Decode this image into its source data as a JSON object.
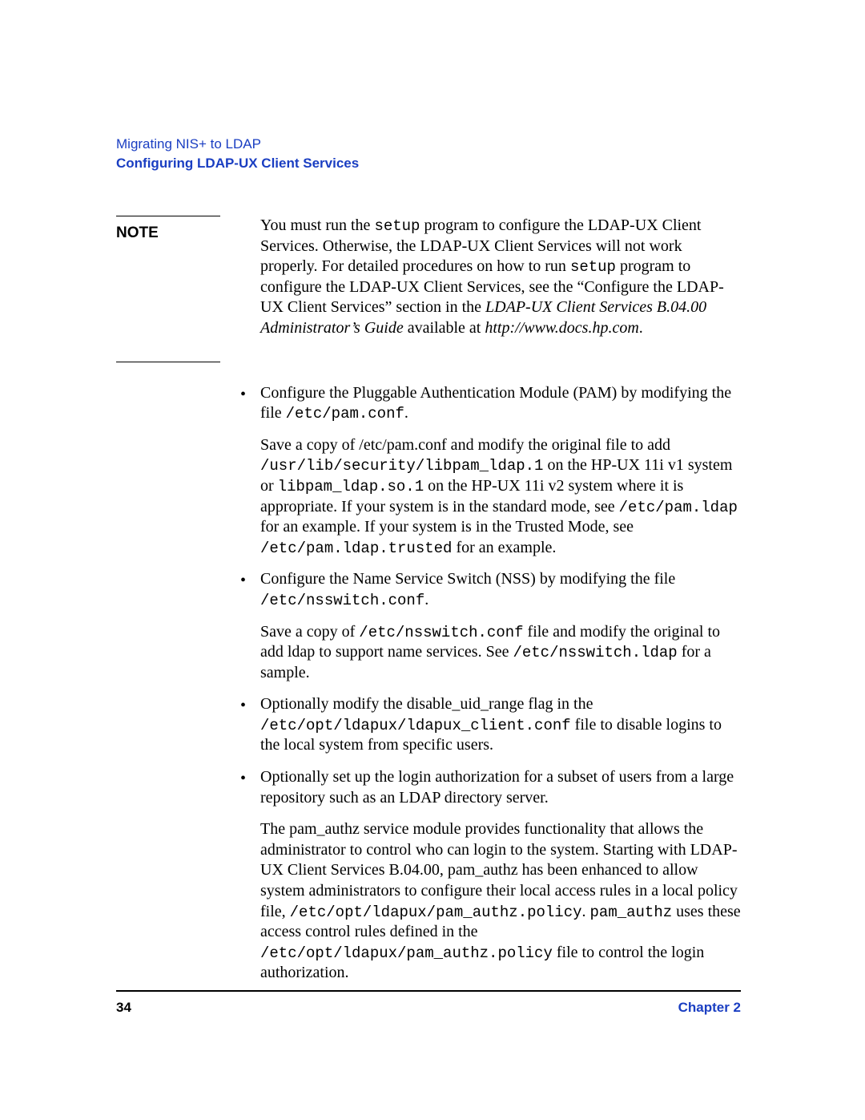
{
  "header": {
    "breadcrumb": "Migrating NIS+ to LDAP",
    "section": "Configuring LDAP-UX Client Services"
  },
  "note": {
    "label": "NOTE",
    "p1_a": "You must run the ",
    "p1_code1": "setup",
    "p1_b": " program to configure the LDAP-UX Client Services. Otherwise, the LDAP-UX Client Services will not work properly. For detailed procedures on how to run ",
    "p1_code2": "setup",
    "p1_c": " program to configure the LDAP-UX Client Services, see the “Configure the LDAP-UX Client Services” section in the ",
    "p1_em1": "LDAP-UX Client Services B.04.00 Administrator’s Guide",
    "p1_d": " available at ",
    "p1_em2": "http://www.docs.hp.com",
    "p1_e": "."
  },
  "bullets": {
    "b1": {
      "t1": "Configure the Pluggable Authentication Module (PAM) by modifying the file ",
      "c1": "/etc/pam.conf",
      "t2": ".",
      "p2_a": " Save a copy of /etc/pam.conf and modify the original file to add ",
      "p2_c1": "/usr/lib/security/libpam_ldap.1",
      "p2_b": " on the HP-UX 11i v1 system or ",
      "p2_c2": "libpam_ldap.so.1",
      "p2_c": " on the HP-UX 11i v2 system where it is appropriate. If your system is in the standard mode, see ",
      "p2_c3": "/etc/pam.ldap",
      "p2_d": " for an example. If your system is in the Trusted Mode, see ",
      "p2_c4": "/etc/pam.ldap.trusted",
      "p2_e": " for an example."
    },
    "b2": {
      "t1": "Configure the Name Service Switch (NSS) by modifying the file ",
      "c1": "/etc/nsswitch.conf",
      "t2": ".",
      "p2_a": "Save a copy of ",
      "p2_c1": "/etc/nsswitch.conf",
      "p2_b": " file and modify the original to add ldap to support name services. See ",
      "p2_c2": "/etc/nsswitch.ldap",
      "p2_c": " for a sample."
    },
    "b3": {
      "t1": "Optionally modify the disable_uid_range flag in the ",
      "c1": "/etc/opt/ldapux/ldapux_client.conf",
      "t2": " file to disable logins to the local system from specific users."
    },
    "b4": {
      "t1": "Optionally set up the login authorization for a subset of users from a large repository such as an LDAP directory server.",
      "p2_a": "The pam_authz service module provides functionality that allows the administrator to control who can login to the system. Starting with LDAP-UX Client Services B.04.00, pam_authz has been enhanced to allow system administrators to configure their local access rules in a local policy file, ",
      "p2_c1": "/etc/opt/ldapux/pam_authz.policy",
      "p2_b": ". ",
      "p2_c2": "pam_authz",
      "p2_c": " uses these access control rules defined in the ",
      "p2_c3": "/etc/opt/ldapux/pam_authz.policy",
      "p2_d": " file to control the login authorization."
    }
  },
  "footer": {
    "page": "34",
    "chapter": "Chapter 2"
  }
}
